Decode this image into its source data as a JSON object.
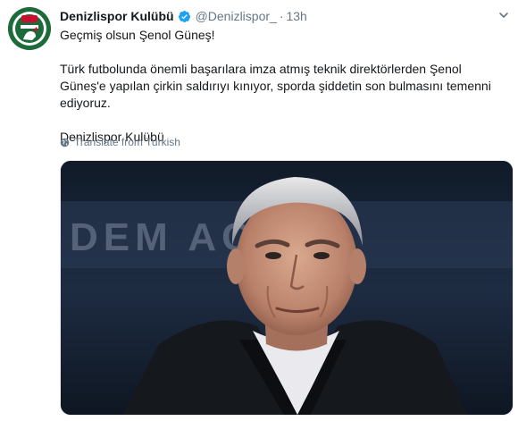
{
  "tweet": {
    "display_name": "Denizlispor Kulübü",
    "handle": "@Denizlispor_",
    "separator": "·",
    "time": "13h",
    "line1": "Geçmiş olsun Şenol Güneş!",
    "body": "Türk futbolunda önemli başarılara imza atmış teknik direktörlerden Şenol Güneş'e yapılan çirkin saldırıyı kınıyor, sporda şiddetin son bulmasını temenni ediyoruz.",
    "signature": "Denizlispor Kulübü",
    "translate_label": "Translate from Turkish"
  },
  "icons": {
    "verified": "verified-badge-icon",
    "caret": "chevron-down-icon",
    "globe": "globe-icon"
  },
  "colors": {
    "verified": "#1da1f2",
    "secondary_text": "#657786",
    "avatar_green": "#1d6b3a"
  },
  "image": {
    "background_text": "DEM ACIB"
  }
}
